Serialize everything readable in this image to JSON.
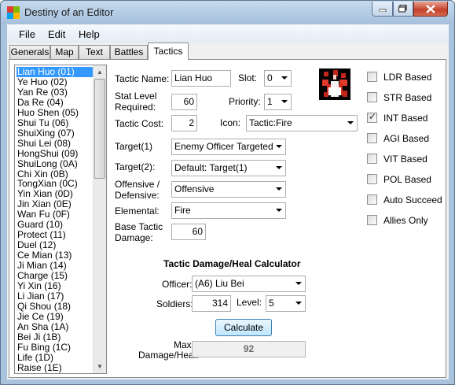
{
  "window": {
    "title": "Destiny of an Editor"
  },
  "menu": [
    "File",
    "Edit",
    "Help"
  ],
  "tabs": [
    "Generals",
    "Map",
    "Text",
    "Battles",
    "Tactics"
  ],
  "tactics_list": [
    "Lian Huo (01)",
    "Ye Huo (02)",
    "Yan Re (03)",
    "Da Re (04)",
    "Huo Shen (05)",
    "Shui Tu (06)",
    "ShuiXing (07)",
    "Shui Lei (08)",
    "HongShui (09)",
    "ShuiLong (0A)",
    "Chi Xin (0B)",
    "TongXian (0C)",
    "Yin Xian (0D)",
    "Jin Xian (0E)",
    "Wan Fu (0F)",
    "Guard (10)",
    "Protect (11)",
    "Duel (12)",
    "Ce Mian (13)",
    "Ji Mian (14)",
    "Charge (15)",
    "Yi Xin (16)",
    "Li Jian (17)",
    "Qi Shou (18)",
    "Jie Ce (19)",
    "An Sha (1A)",
    "Bei Ji (1B)",
    "Fu Bing (1C)",
    "Life (1D)",
    "Raise (1E)"
  ],
  "form": {
    "tactic_name_label": "Tactic Name:",
    "tactic_name": "Lian Huo",
    "slot_label": "Slot:",
    "slot": "0",
    "stat_level_label_1": "Stat Level",
    "stat_level_label_2": "Required:",
    "stat_level": "60",
    "priority_label": "Priority:",
    "priority": "1",
    "tactic_cost_label": "Tactic Cost:",
    "tactic_cost": "2",
    "icon_label": "Icon:",
    "icon": "Tactic:Fire",
    "target1_label": "Target(1)",
    "target1": "Enemy Officer Targeted",
    "target2_label": "Target(2):",
    "target2": "Default: Target(1)",
    "offdef_label_1": "Offensive /",
    "offdef_label_2": "Defensive:",
    "offdef": "Offensive",
    "elemental_label": "Elemental:",
    "elemental": "Fire",
    "base_damage_label_1": "Base Tactic",
    "base_damage_label_2": "Damage:",
    "base_damage": "60"
  },
  "checkboxes": [
    {
      "label": "LDR Based",
      "checked": false
    },
    {
      "label": "STR Based",
      "checked": false
    },
    {
      "label": "INT Based",
      "checked": true
    },
    {
      "label": "AGI Based",
      "checked": false
    },
    {
      "label": "VIT Based",
      "checked": false
    },
    {
      "label": "POL Based",
      "checked": false
    },
    {
      "label": "Auto Succeed",
      "checked": false
    },
    {
      "label": "Allies Only",
      "checked": false
    }
  ],
  "calculator": {
    "heading": "Tactic Damage/Heal Calculator",
    "officer_label": "Officer:",
    "officer": "(A6) Liu Bei",
    "soldiers_label": "Soldiers:",
    "soldiers": "314",
    "level_label": "Level:",
    "level": "5",
    "calculate_label": "Calculate",
    "max_label_1": "Max",
    "max_label_2": "Damage/Heal:",
    "max_value": "92"
  }
}
